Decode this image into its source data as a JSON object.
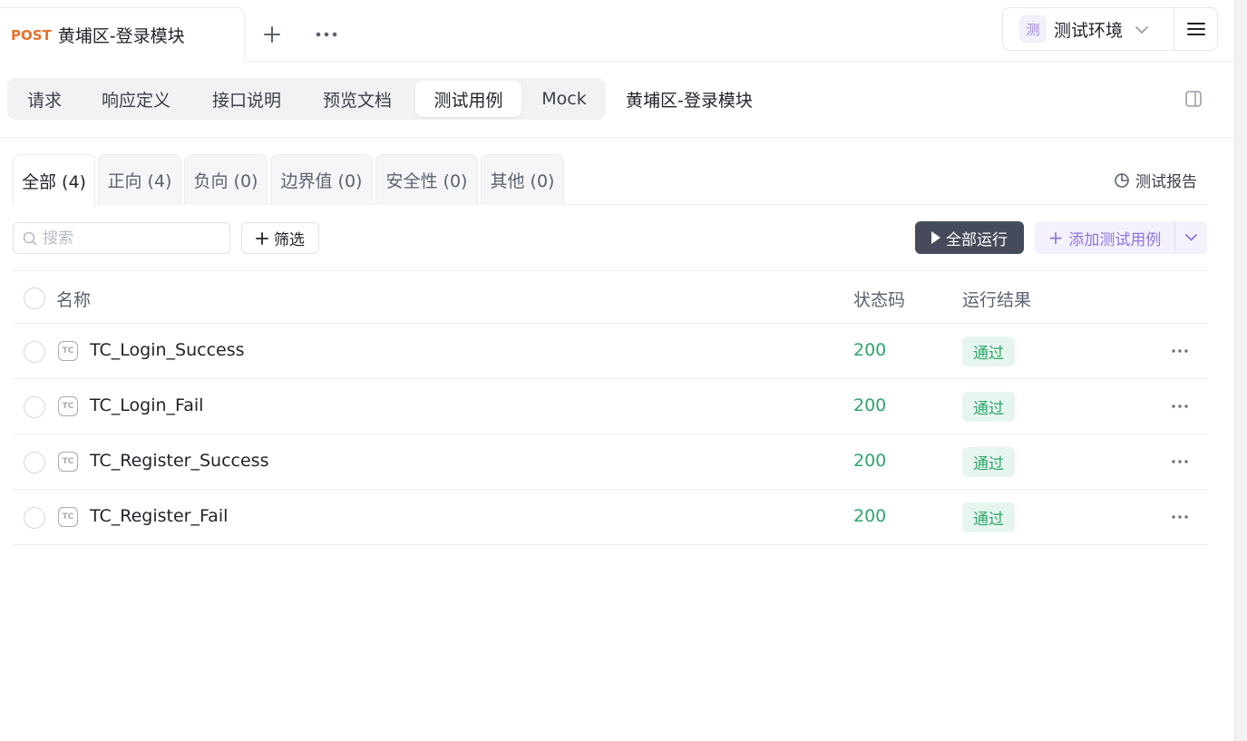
{
  "doc_tab": {
    "method": "POST",
    "title": "黄埔区-登录模块"
  },
  "icons": {
    "add": "plus-icon",
    "more": "ellipsis-icon",
    "env_chevron": "chevron-down-icon",
    "menu": "hamburger-menu-icon",
    "panel": "side-panel-icon",
    "report": "pie-chart-icon",
    "search": "search-icon",
    "run": "play-icon",
    "case": "test-case-icon"
  },
  "env": {
    "badge": "测",
    "label": "测试环境"
  },
  "subtabs": [
    {
      "label": "请求"
    },
    {
      "label": "响应定义"
    },
    {
      "label": "接口说明"
    },
    {
      "label": "预览文档"
    },
    {
      "label": "测试用例",
      "active": true
    },
    {
      "label": "Mock"
    }
  ],
  "sub_title": "黄埔区-登录模块",
  "categories": [
    {
      "label": "全部 (4)",
      "active": true
    },
    {
      "label": "正向 (4)"
    },
    {
      "label": "负向 (0)"
    },
    {
      "label": "边界值 (0)"
    },
    {
      "label": "安全性 (0)"
    },
    {
      "label": "其他 (0)"
    }
  ],
  "report_label": "测试报告",
  "search": {
    "placeholder": "搜索",
    "value": ""
  },
  "filter_label": "筛选",
  "run_all_label": "全部运行",
  "add_case_label": "添加测试用例",
  "table": {
    "headers": {
      "name": "名称",
      "status": "状态码",
      "result": "运行结果"
    },
    "rows": [
      {
        "icon_text": "TC",
        "name": "TC_Login_Success",
        "status": "200",
        "result": "通过"
      },
      {
        "icon_text": "TC",
        "name": "TC_Login_Fail",
        "status": "200",
        "result": "通过"
      },
      {
        "icon_text": "TC",
        "name": "TC_Register_Success",
        "status": "200",
        "result": "通过"
      },
      {
        "icon_text": "TC",
        "name": "TC_Register_Fail",
        "status": "200",
        "result": "通过"
      }
    ]
  },
  "colors": {
    "method": "#e8702a",
    "status_ok": "#2ea66b",
    "badge_bg": "#e6f6ee",
    "primary_dark": "#454b5a",
    "accent_purple": "#8f74db"
  }
}
